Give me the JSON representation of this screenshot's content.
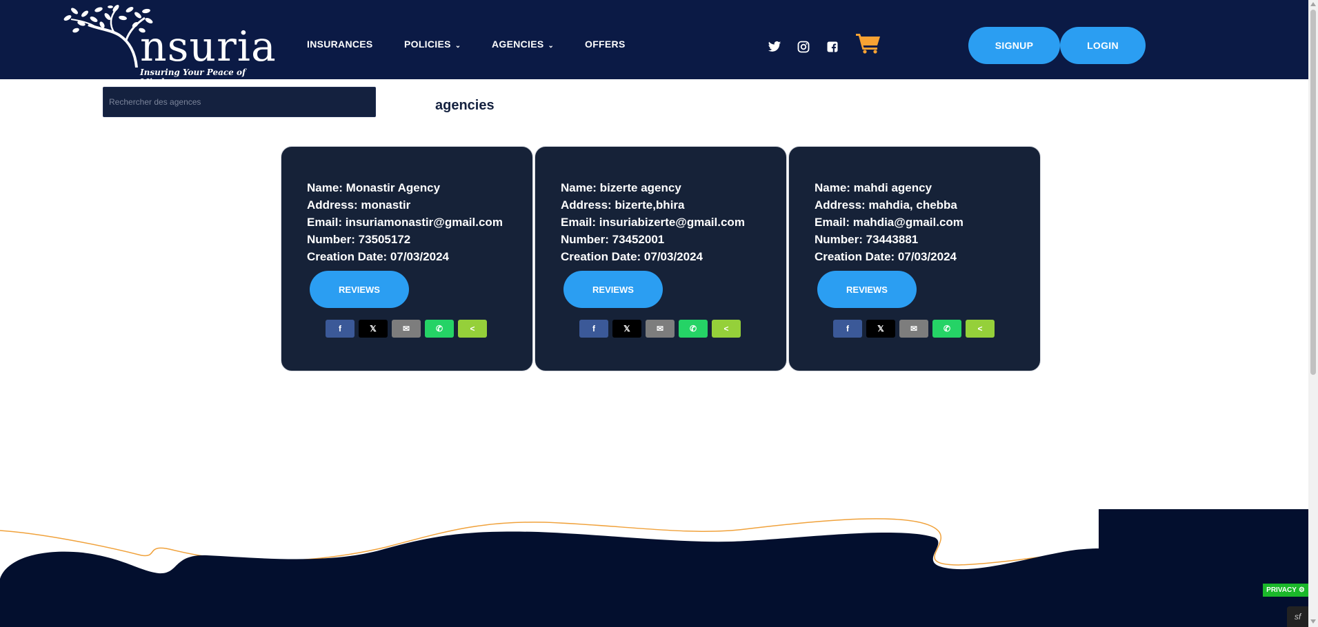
{
  "brand": {
    "name": "nsuria",
    "tagline": "Insuring Your Peace of Mind"
  },
  "nav": {
    "items": [
      {
        "label": "INSURANCES",
        "dropdown": false
      },
      {
        "label": "POLICIES",
        "dropdown": true
      },
      {
        "label": "AGENCIES",
        "dropdown": true
      },
      {
        "label": "OFFERS",
        "dropdown": false
      }
    ]
  },
  "social": [
    "twitter-icon",
    "instagram-icon",
    "facebook-icon"
  ],
  "auth": {
    "signup": "SIGNUP",
    "login": "LOGIN"
  },
  "search": {
    "placeholder": "Rechercher des agences",
    "value": ""
  },
  "page": {
    "title": "agencies"
  },
  "agencies": [
    {
      "name": "Name: Monastir Agency",
      "address": "Address: monastir",
      "email": "Email: insuriamonastir@gmail.com",
      "number": "Number: 73505172",
      "created": "Creation Date: 07/03/2024",
      "reviews": "REVIEWS"
    },
    {
      "name": "Name: bizerte agency",
      "address": "Address: bizerte,bhira",
      "email": "Email: insuriabizerte@gmail.com",
      "number": "Number: 73452001",
      "created": "Creation Date: 07/03/2024",
      "reviews": "REVIEWS"
    },
    {
      "name": "Name: mahdi agency",
      "address": "Address: mahdia, chebba",
      "email": "Email: mahdia@gmail.com",
      "number": "Number: 73443881",
      "created": "Creation Date: 07/03/2024",
      "reviews": "REVIEWS"
    }
  ],
  "share_buttons": [
    {
      "icon": "facebook-icon",
      "glyph": "f",
      "color": "#3b5998"
    },
    {
      "icon": "x-icon",
      "glyph": "𝕏",
      "color": "#000000"
    },
    {
      "icon": "email-icon",
      "glyph": "✉",
      "color": "#7d7d7d"
    },
    {
      "icon": "whatsapp-icon",
      "glyph": "✆",
      "color": "#25d366"
    },
    {
      "icon": "share-icon",
      "glyph": "<",
      "color": "#95d03a"
    }
  ],
  "footer": {
    "privacy": "PRIVACY"
  },
  "colors": {
    "header": "#0b1a45",
    "accent": "#2b9ef2",
    "card": "#162238",
    "cart": "#f7a233",
    "footer": "#030f2e",
    "wave_line": "#f0a13a"
  }
}
